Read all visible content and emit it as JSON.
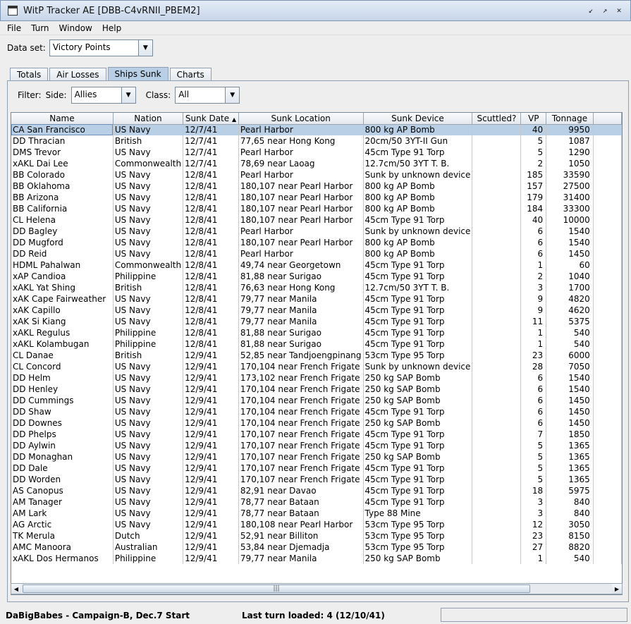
{
  "window": {
    "title": "WitP Tracker AE [DBB-C4vRNII_PBEM2]"
  },
  "menu": [
    "File",
    "Turn",
    "Window",
    "Help"
  ],
  "dataset": {
    "label": "Data set:",
    "value": "Victory Points"
  },
  "tabs": [
    "Totals",
    "Air Losses",
    "Ships Sunk",
    "Charts"
  ],
  "active_tab": "Ships Sunk",
  "filters": {
    "label": "Filter:",
    "side_label": "Side:",
    "side_value": "Allies",
    "class_label": "Class:",
    "class_value": "All"
  },
  "table": {
    "columns": [
      "Name",
      "Nation",
      "Sunk Date",
      "Sunk Location",
      "Sunk Device",
      "Scuttled?",
      "VP",
      "Tonnage"
    ],
    "sort_column": "Sunk Date",
    "rows": [
      [
        "CA San Francisco",
        "US Navy",
        "12/7/41",
        "Pearl Harbor",
        "800 kg AP Bomb",
        "",
        "40",
        "9950"
      ],
      [
        "DD Thracian",
        "British",
        "12/7/41",
        "77,65 near Hong Kong",
        "20cm/50 3YT-II Gun",
        "",
        "5",
        "1087"
      ],
      [
        "DMS Trevor",
        "US Navy",
        "12/7/41",
        "Pearl Harbor",
        "45cm Type 91 Torp",
        "",
        "5",
        "1290"
      ],
      [
        "xAKL Dai Lee",
        "Commonwealth",
        "12/7/41",
        "78,69 near Laoag",
        "12.7cm/50 3YT T. B.",
        "",
        "2",
        "1050"
      ],
      [
        "BB Colorado",
        "US Navy",
        "12/8/41",
        "Pearl Harbor",
        "Sunk by unknown device",
        "",
        "185",
        "33590"
      ],
      [
        "BB Oklahoma",
        "US Navy",
        "12/8/41",
        "180,107 near Pearl Harbor",
        "800 kg AP Bomb",
        "",
        "157",
        "27500"
      ],
      [
        "BB Arizona",
        "US Navy",
        "12/8/41",
        "180,107 near Pearl Harbor",
        "800 kg AP Bomb",
        "",
        "179",
        "31400"
      ],
      [
        "BB California",
        "US Navy",
        "12/8/41",
        "180,107 near Pearl Harbor",
        "800 kg AP Bomb",
        "",
        "184",
        "33300"
      ],
      [
        "CL Helena",
        "US Navy",
        "12/8/41",
        "180,107 near Pearl Harbor",
        "45cm Type 91 Torp",
        "",
        "40",
        "10000"
      ],
      [
        "DD Bagley",
        "US Navy",
        "12/8/41",
        "Pearl Harbor",
        "Sunk by unknown device",
        "",
        "6",
        "1540"
      ],
      [
        "DD Mugford",
        "US Navy",
        "12/8/41",
        "180,107 near Pearl Harbor",
        "800 kg AP Bomb",
        "",
        "6",
        "1540"
      ],
      [
        "DD Reid",
        "US Navy",
        "12/8/41",
        "Pearl Harbor",
        "800 kg AP Bomb",
        "",
        "6",
        "1450"
      ],
      [
        "HDML Pahalwan",
        "Commonwealth",
        "12/8/41",
        "49,74 near Georgetown",
        "45cm Type 91 Torp",
        "",
        "1",
        "60"
      ],
      [
        "xAP Candioa",
        "Philippine",
        "12/8/41",
        "81,88 near Surigao",
        "45cm Type 91 Torp",
        "",
        "2",
        "1040"
      ],
      [
        "xAKL Yat Shing",
        "British",
        "12/8/41",
        "76,63 near Hong Kong",
        "12.7cm/50 3YT T. B.",
        "",
        "3",
        "1700"
      ],
      [
        "xAK Cape Fairweather",
        "US Navy",
        "12/8/41",
        "79,77 near Manila",
        "45cm Type 91 Torp",
        "",
        "9",
        "4820"
      ],
      [
        "xAK Capillo",
        "US Navy",
        "12/8/41",
        "79,77 near Manila",
        "45cm Type 91 Torp",
        "",
        "9",
        "4620"
      ],
      [
        "xAK Si Kiang",
        "US Navy",
        "12/8/41",
        "79,77 near Manila",
        "45cm Type 91 Torp",
        "",
        "11",
        "5375"
      ],
      [
        "xAKL Regulus",
        "Philippine",
        "12/8/41",
        "81,88 near Surigao",
        "45cm Type 91 Torp",
        "",
        "1",
        "540"
      ],
      [
        "xAKL Kolambugan",
        "Philippine",
        "12/8/41",
        "81,88 near Surigao",
        "45cm Type 91 Torp",
        "",
        "1",
        "540"
      ],
      [
        "CL Danae",
        "British",
        "12/9/41",
        "52,85 near Tandjoengpinang",
        "53cm Type 95 Torp",
        "",
        "23",
        "6000"
      ],
      [
        "CL Concord",
        "US Navy",
        "12/9/41",
        "170,104 near French Frigate",
        "Sunk by unknown device",
        "",
        "28",
        "7050"
      ],
      [
        "DD Helm",
        "US Navy",
        "12/9/41",
        "173,102 near French Frigate",
        "250 kg SAP Bomb",
        "",
        "6",
        "1540"
      ],
      [
        "DD Henley",
        "US Navy",
        "12/9/41",
        "170,104 near French Frigate",
        "250 kg SAP Bomb",
        "",
        "6",
        "1540"
      ],
      [
        "DD Cummings",
        "US Navy",
        "12/9/41",
        "170,104 near French Frigate",
        "250 kg SAP Bomb",
        "",
        "6",
        "1450"
      ],
      [
        "DD Shaw",
        "US Navy",
        "12/9/41",
        "170,104 near French Frigate",
        "45cm Type 91 Torp",
        "",
        "6",
        "1450"
      ],
      [
        "DD Downes",
        "US Navy",
        "12/9/41",
        "170,104 near French Frigate",
        "250 kg SAP Bomb",
        "",
        "6",
        "1450"
      ],
      [
        "DD Phelps",
        "US Navy",
        "12/9/41",
        "170,107 near French Frigate",
        "45cm Type 91 Torp",
        "",
        "7",
        "1850"
      ],
      [
        "DD Aylwin",
        "US Navy",
        "12/9/41",
        "170,107 near French Frigate",
        "45cm Type 91 Torp",
        "",
        "5",
        "1365"
      ],
      [
        "DD Monaghan",
        "US Navy",
        "12/9/41",
        "170,107 near French Frigate",
        "250 kg SAP Bomb",
        "",
        "5",
        "1365"
      ],
      [
        "DD Dale",
        "US Navy",
        "12/9/41",
        "170,107 near French Frigate",
        "45cm Type 91 Torp",
        "",
        "5",
        "1365"
      ],
      [
        "DD Worden",
        "US Navy",
        "12/9/41",
        "170,107 near French Frigate",
        "45cm Type 91 Torp",
        "",
        "5",
        "1365"
      ],
      [
        "AS Canopus",
        "US Navy",
        "12/9/41",
        "82,91 near Davao",
        "45cm Type 91 Torp",
        "",
        "18",
        "5975"
      ],
      [
        "AM Tanager",
        "US Navy",
        "12/9/41",
        "78,77 near Bataan",
        "45cm Type 91 Torp",
        "",
        "3",
        "840"
      ],
      [
        "AM Lark",
        "US Navy",
        "12/9/41",
        "78,77 near Bataan",
        "Type 88 Mine",
        "",
        "3",
        "840"
      ],
      [
        "AG Arctic",
        "US Navy",
        "12/9/41",
        "180,108 near Pearl Harbor",
        "53cm Type 95 Torp",
        "",
        "12",
        "3050"
      ],
      [
        "TK Merula",
        "Dutch",
        "12/9/41",
        "52,91 near Billiton",
        "53cm Type 95 Torp",
        "",
        "23",
        "8150"
      ],
      [
        "AMC Manoora",
        "Australian",
        "12/9/41",
        "53,84 near Djemadja",
        "53cm Type 95 Torp",
        "",
        "27",
        "8820"
      ],
      [
        "xAKL Dos Hermanos",
        "Philippine",
        "12/9/41",
        "79,77 near Manila",
        "250 kg SAP Bomb",
        "",
        "1",
        "540"
      ]
    ],
    "selected_row": 0
  },
  "status": {
    "left": "DaBigBabes - Campaign-B, Dec.7 Start",
    "middle": "Last turn loaded: 4 (12/10/41)"
  }
}
